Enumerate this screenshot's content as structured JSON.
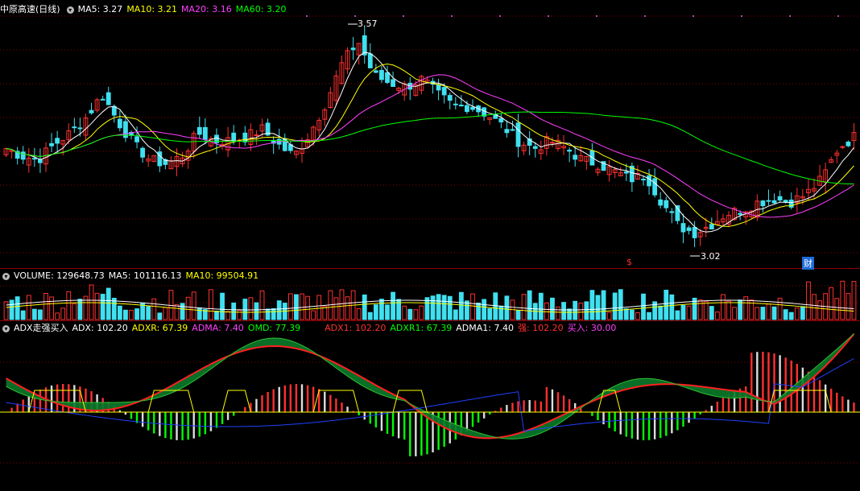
{
  "price_panel": {
    "stock": "中原高速(日线)",
    "ma5": "MA5: 3.27",
    "ma10": "MA10: 3.21",
    "ma20": "MA20: 3.16",
    "ma60": "MA60: 3.20",
    "high_label": "3.57",
    "low_label": "3.02",
    "marker_s": "$",
    "marker_cai": "财"
  },
  "volume_panel": {
    "volume": "VOLUME: 129648.73",
    "ma5": "MA5: 101116.13",
    "ma10": "MA10: 99504.91"
  },
  "adx_panel": {
    "name": "ADX走强买入",
    "adx": "ADX: 102.20",
    "adxr": "ADXR: 67.39",
    "adma": "ADMA: 7.40",
    "omd": "OMD: 77.39",
    "adx1": "ADX1: 102.20",
    "adxr1": "ADXR1: 67.39",
    "adma1": "ADMA1: 7.40",
    "strong": "强: 102.20",
    "buy": "买入: 30.00"
  },
  "colors": {
    "up": "#ff3030",
    "down": "#40e0f0",
    "ma5": "#ffffff",
    "ma10": "#ffff00",
    "ma20": "#ff40ff",
    "ma60": "#00ff00",
    "grid": "#8b0000"
  },
  "icons": [
    "toggle-icon"
  ],
  "chart_data": {
    "type": "candlestick",
    "note_levels": {
      "high": 3.57,
      "low": 3.02
    },
    "close_anchors": [
      3.26,
      3.24,
      3.23,
      3.27,
      3.3,
      3.34,
      3.4,
      3.33,
      3.27,
      3.23,
      3.22,
      3.24,
      3.3,
      3.28,
      3.28,
      3.29,
      3.31,
      3.27,
      3.24,
      3.3,
      3.38,
      3.48,
      3.54,
      3.45,
      3.43,
      3.42,
      3.44,
      3.4,
      3.37,
      3.37,
      3.35,
      3.32,
      3.28,
      3.26,
      3.28,
      3.26,
      3.23,
      3.22,
      3.2,
      3.18,
      3.19,
      3.12,
      3.06,
      3.04,
      3.06,
      3.09,
      3.1,
      3.12,
      3.13,
      3.12,
      3.14,
      3.18,
      3.26,
      3.29
    ]
  }
}
